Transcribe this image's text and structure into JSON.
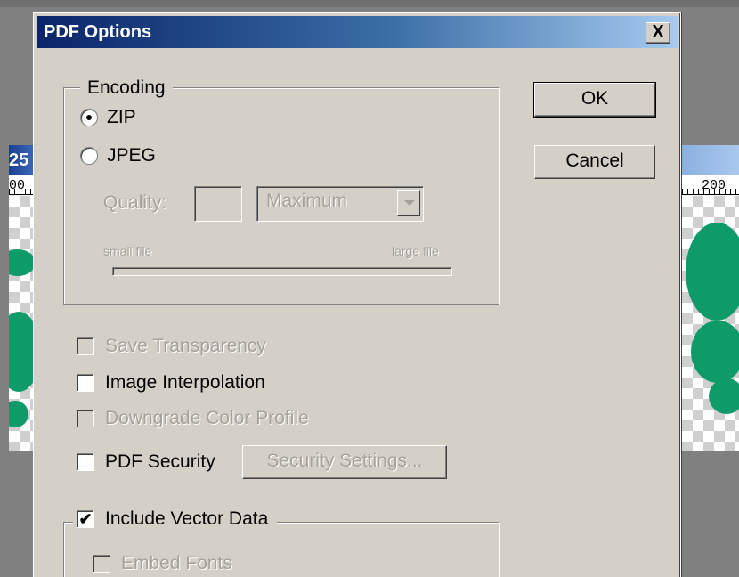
{
  "background": {
    "left_window_title": "25",
    "left_ruler_label": "00",
    "right_ruler_label": "200"
  },
  "dialog": {
    "title": "PDF Options",
    "close_label": "X",
    "ok_label": "OK",
    "cancel_label": "Cancel"
  },
  "encoding": {
    "legend": "Encoding",
    "zip_label": "ZIP",
    "jpeg_label": "JPEG",
    "selected": "ZIP",
    "quality_label": "Quality:",
    "quality_value": "",
    "quality_select_value": "Maximum",
    "small_file_label": "small file",
    "large_file_label": "large file"
  },
  "options": {
    "save_transparency": {
      "label": "Save Transparency",
      "checked": false,
      "enabled": false
    },
    "image_interpolation": {
      "label": "Image Interpolation",
      "checked": false,
      "enabled": true
    },
    "downgrade_color_profile": {
      "label": "Downgrade Color Profile",
      "checked": false,
      "enabled": false
    },
    "pdf_security": {
      "label": "PDF Security",
      "checked": false,
      "enabled": true
    },
    "security_settings_label": "Security Settings..."
  },
  "vector": {
    "include_vector_data": {
      "label": "Include Vector Data",
      "checked": true,
      "check_glyph": "✔"
    },
    "embed_fonts": {
      "label": "Embed Fonts",
      "checked": false,
      "enabled": false
    }
  },
  "colors": {
    "face": "#d4d0c8",
    "title_start": "#0a246a",
    "title_end": "#a6caf0",
    "disabled_text": "#a5a29a",
    "canvas_green": "#0f9a69"
  }
}
